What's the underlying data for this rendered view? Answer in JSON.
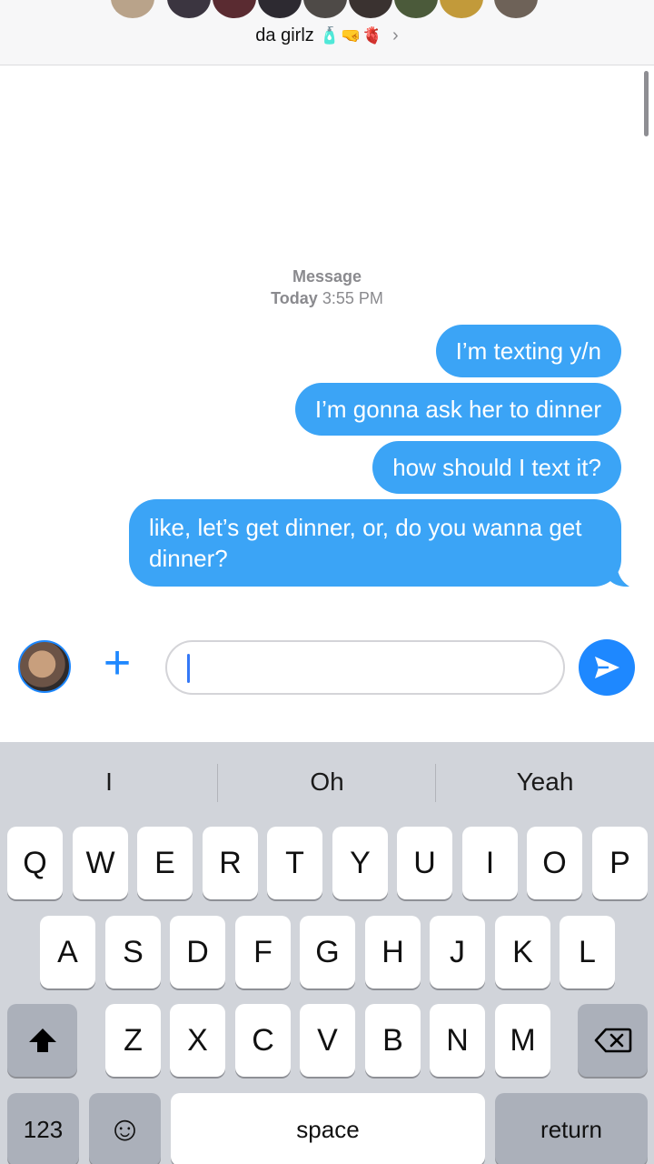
{
  "header": {
    "group_name": "da girlz",
    "group_emojis": "🧴🤜🫀",
    "chevron": "›"
  },
  "conversation": {
    "timestamp_label": "Message",
    "timestamp_day": "Today",
    "timestamp_time": "3:55 PM",
    "messages": [
      {
        "text": "I’m texting y/n"
      },
      {
        "text": "I’m gonna ask her to dinner"
      },
      {
        "text": "how should I text it?"
      },
      {
        "text": "like, let’s get dinner, or, do you wanna get dinner?"
      }
    ]
  },
  "compose": {
    "input_value": "",
    "plus_glyph": "+"
  },
  "keyboard": {
    "suggestions": [
      "I",
      "Oh",
      "Yeah"
    ],
    "row1": [
      "Q",
      "W",
      "E",
      "R",
      "T",
      "Y",
      "U",
      "I",
      "O",
      "P"
    ],
    "row2": [
      "A",
      "S",
      "D",
      "F",
      "G",
      "H",
      "J",
      "K",
      "L"
    ],
    "row3": [
      "Z",
      "X",
      "C",
      "V",
      "B",
      "N",
      "M"
    ],
    "numbers_label": "123",
    "emoji_glyph": "☺",
    "space_label": "space",
    "return_label": "return"
  },
  "colors": {
    "bubble_blue": "#3ba4f6",
    "accent_blue": "#1e88ff",
    "keyboard_bg": "#d1d4da"
  }
}
